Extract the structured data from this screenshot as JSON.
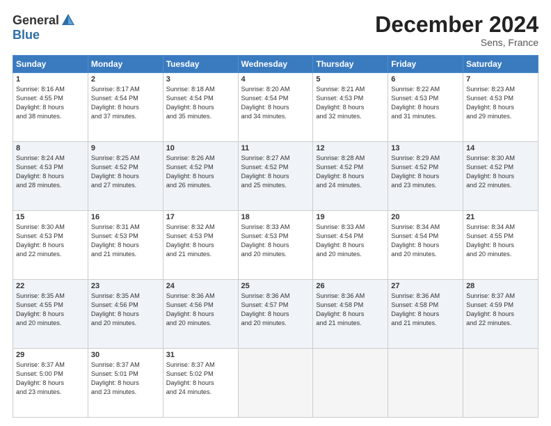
{
  "logo": {
    "general": "General",
    "blue": "Blue"
  },
  "title": "December 2024",
  "location": "Sens, France",
  "days_of_week": [
    "Sunday",
    "Monday",
    "Tuesday",
    "Wednesday",
    "Thursday",
    "Friday",
    "Saturday"
  ],
  "weeks": [
    [
      {
        "day": "1",
        "info": "Sunrise: 8:16 AM\nSunset: 4:55 PM\nDaylight: 8 hours\nand 38 minutes."
      },
      {
        "day": "2",
        "info": "Sunrise: 8:17 AM\nSunset: 4:54 PM\nDaylight: 8 hours\nand 37 minutes."
      },
      {
        "day": "3",
        "info": "Sunrise: 8:18 AM\nSunset: 4:54 PM\nDaylight: 8 hours\nand 35 minutes."
      },
      {
        "day": "4",
        "info": "Sunrise: 8:20 AM\nSunset: 4:54 PM\nDaylight: 8 hours\nand 34 minutes."
      },
      {
        "day": "5",
        "info": "Sunrise: 8:21 AM\nSunset: 4:53 PM\nDaylight: 8 hours\nand 32 minutes."
      },
      {
        "day": "6",
        "info": "Sunrise: 8:22 AM\nSunset: 4:53 PM\nDaylight: 8 hours\nand 31 minutes."
      },
      {
        "day": "7",
        "info": "Sunrise: 8:23 AM\nSunset: 4:53 PM\nDaylight: 8 hours\nand 29 minutes."
      }
    ],
    [
      {
        "day": "8",
        "info": "Sunrise: 8:24 AM\nSunset: 4:53 PM\nDaylight: 8 hours\nand 28 minutes."
      },
      {
        "day": "9",
        "info": "Sunrise: 8:25 AM\nSunset: 4:52 PM\nDaylight: 8 hours\nand 27 minutes."
      },
      {
        "day": "10",
        "info": "Sunrise: 8:26 AM\nSunset: 4:52 PM\nDaylight: 8 hours\nand 26 minutes."
      },
      {
        "day": "11",
        "info": "Sunrise: 8:27 AM\nSunset: 4:52 PM\nDaylight: 8 hours\nand 25 minutes."
      },
      {
        "day": "12",
        "info": "Sunrise: 8:28 AM\nSunset: 4:52 PM\nDaylight: 8 hours\nand 24 minutes."
      },
      {
        "day": "13",
        "info": "Sunrise: 8:29 AM\nSunset: 4:52 PM\nDaylight: 8 hours\nand 23 minutes."
      },
      {
        "day": "14",
        "info": "Sunrise: 8:30 AM\nSunset: 4:52 PM\nDaylight: 8 hours\nand 22 minutes."
      }
    ],
    [
      {
        "day": "15",
        "info": "Sunrise: 8:30 AM\nSunset: 4:53 PM\nDaylight: 8 hours\nand 22 minutes."
      },
      {
        "day": "16",
        "info": "Sunrise: 8:31 AM\nSunset: 4:53 PM\nDaylight: 8 hours\nand 21 minutes."
      },
      {
        "day": "17",
        "info": "Sunrise: 8:32 AM\nSunset: 4:53 PM\nDaylight: 8 hours\nand 21 minutes."
      },
      {
        "day": "18",
        "info": "Sunrise: 8:33 AM\nSunset: 4:53 PM\nDaylight: 8 hours\nand 20 minutes."
      },
      {
        "day": "19",
        "info": "Sunrise: 8:33 AM\nSunset: 4:54 PM\nDaylight: 8 hours\nand 20 minutes."
      },
      {
        "day": "20",
        "info": "Sunrise: 8:34 AM\nSunset: 4:54 PM\nDaylight: 8 hours\nand 20 minutes."
      },
      {
        "day": "21",
        "info": "Sunrise: 8:34 AM\nSunset: 4:55 PM\nDaylight: 8 hours\nand 20 minutes."
      }
    ],
    [
      {
        "day": "22",
        "info": "Sunrise: 8:35 AM\nSunset: 4:55 PM\nDaylight: 8 hours\nand 20 minutes."
      },
      {
        "day": "23",
        "info": "Sunrise: 8:35 AM\nSunset: 4:56 PM\nDaylight: 8 hours\nand 20 minutes."
      },
      {
        "day": "24",
        "info": "Sunrise: 8:36 AM\nSunset: 4:56 PM\nDaylight: 8 hours\nand 20 minutes."
      },
      {
        "day": "25",
        "info": "Sunrise: 8:36 AM\nSunset: 4:57 PM\nDaylight: 8 hours\nand 20 minutes."
      },
      {
        "day": "26",
        "info": "Sunrise: 8:36 AM\nSunset: 4:58 PM\nDaylight: 8 hours\nand 21 minutes."
      },
      {
        "day": "27",
        "info": "Sunrise: 8:36 AM\nSunset: 4:58 PM\nDaylight: 8 hours\nand 21 minutes."
      },
      {
        "day": "28",
        "info": "Sunrise: 8:37 AM\nSunset: 4:59 PM\nDaylight: 8 hours\nand 22 minutes."
      }
    ],
    [
      {
        "day": "29",
        "info": "Sunrise: 8:37 AM\nSunset: 5:00 PM\nDaylight: 8 hours\nand 23 minutes."
      },
      {
        "day": "30",
        "info": "Sunrise: 8:37 AM\nSunset: 5:01 PM\nDaylight: 8 hours\nand 23 minutes."
      },
      {
        "day": "31",
        "info": "Sunrise: 8:37 AM\nSunset: 5:02 PM\nDaylight: 8 hours\nand 24 minutes."
      },
      null,
      null,
      null,
      null
    ]
  ]
}
